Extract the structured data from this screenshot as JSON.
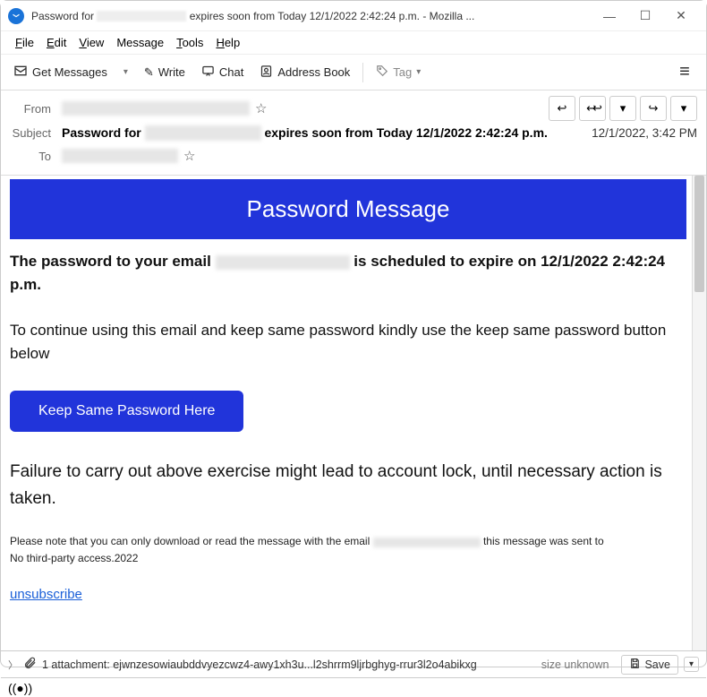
{
  "window": {
    "title_prefix": "Password for",
    "title_suffix": " expires soon from Today 12/1/2022 2:42:24 p.m. - Mozilla ..."
  },
  "menubar": {
    "file": "File",
    "edit": "Edit",
    "view": "View",
    "message": "Message",
    "tools": "Tools",
    "help": "Help"
  },
  "toolbar": {
    "get_messages": "Get Messages",
    "write": "Write",
    "chat": "Chat",
    "address_book": "Address Book",
    "tag": "Tag"
  },
  "headers": {
    "from_label": "From",
    "subject_label": "Subject",
    "to_label": "To",
    "subject_prefix": "Password for",
    "subject_suffix": "expires soon from Today 12/1/2022 2:42:24 p.m.",
    "date": "12/1/2022, 3:42 PM"
  },
  "email": {
    "banner": "Password Message",
    "line1_prefix": "The password to your email",
    "line1_suffix": "is scheduled to expire on 12/1/2022 2:42:24 p.m.",
    "line2": "To continue using this email and keep same password kindly use the keep same password button below",
    "cta": "Keep Same Password Here",
    "warn": "Failure to carry out above exercise might lead to account lock, until necessary action is taken.",
    "note_prefix": "Please note that you can only download or read the message with the email",
    "note_suffix": "this message was sent to",
    "note2": "No third-party access.2022",
    "unsubscribe": " unsubscribe"
  },
  "attachment": {
    "text": "1 attachment: ejwnzesowiaubddvyezcwz4-awy1xh3u...l2shrrm9ljrbghyg-rrur3l2o4abikxg",
    "size": "size unknown",
    "save": "Save"
  }
}
